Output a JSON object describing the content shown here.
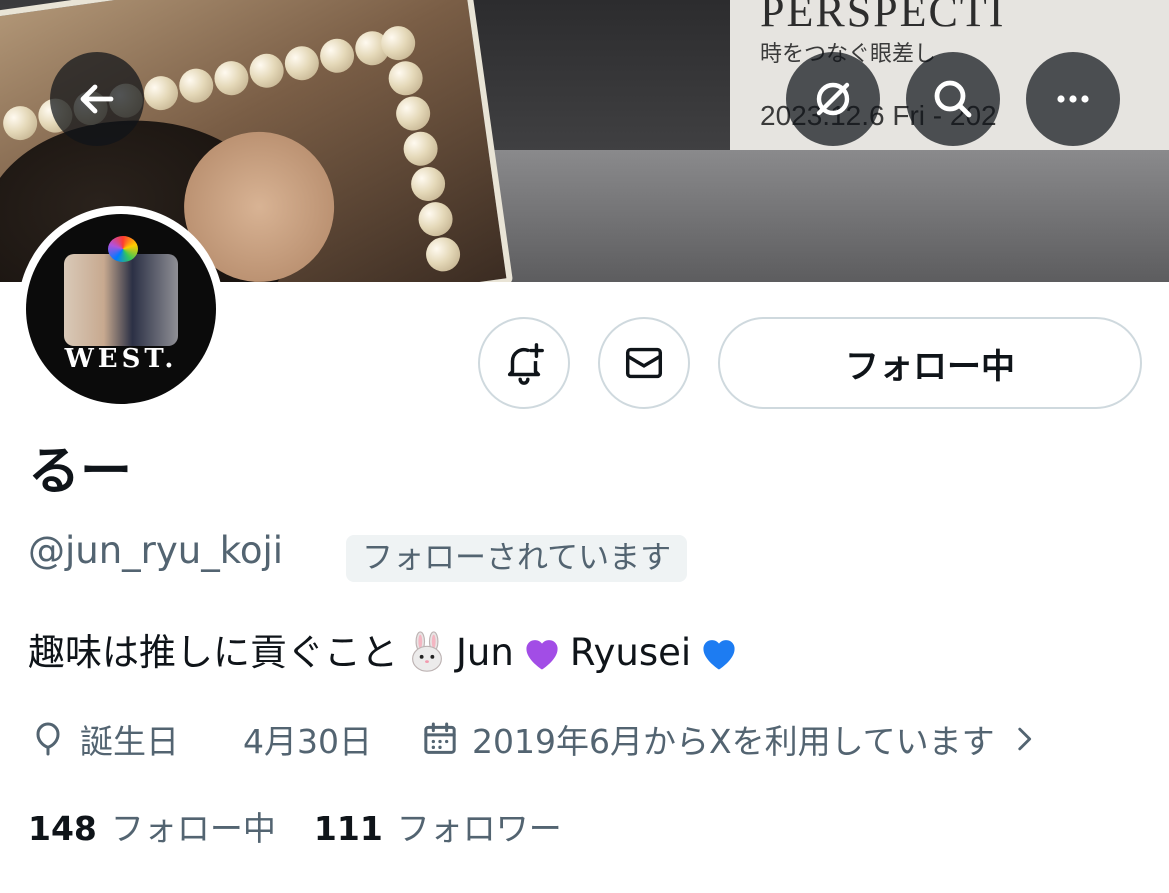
{
  "profile": {
    "display_name": "るー",
    "handle": "@jun_ryu_koji",
    "follows_you_badge": "フォローされています",
    "bio": {
      "text_main": "趣味は推しに貢ぐこと",
      "emoji_rabbit": "rabbit-face-emoji",
      "text_jun": "Jun",
      "emoji_purple": "purple-heart-emoji",
      "text_ryusei": "Ryusei",
      "emoji_blue": "blue-heart-emoji"
    },
    "birthday_label": "誕生日",
    "birthday_value": "4月30日",
    "joined_text": "2019年6月からXを利用しています",
    "following_count": "148",
    "following_label": "フォロー中",
    "followers_count": "111",
    "followers_label": "フォロワー",
    "avatar_text": "WEST."
  },
  "actions": {
    "follow_button_label": "フォロー中",
    "notify_icon": "bell-plus-icon",
    "message_icon": "envelope-icon"
  },
  "header": {
    "back_icon": "back-arrow-icon",
    "grok_icon": "grok-icon",
    "search_icon": "search-icon",
    "more_icon": "more-icon"
  },
  "banner": {
    "sign_title": "PERSPECTI",
    "sign_subtitle": "時をつなぐ眼差し",
    "sign_date": "2023.12.6 Fri - 202"
  },
  "colors": {
    "text_primary": "#0f1419",
    "text_secondary": "#536471",
    "border": "#cfd9de",
    "badge_bg": "#eff3f4",
    "header_button_bg": "#0f1419"
  }
}
